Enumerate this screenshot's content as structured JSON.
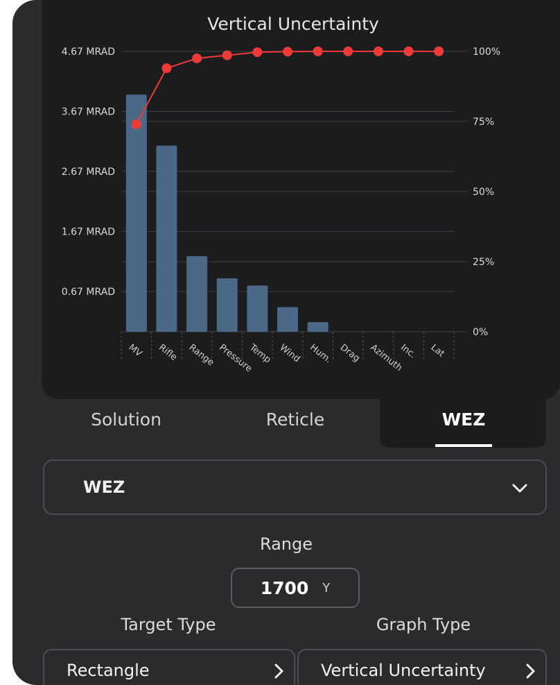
{
  "chart_data": {
    "type": "bar",
    "title": "Vertical Uncertainty",
    "categories": [
      "MV",
      "Rifle",
      "Range",
      "Pressure",
      "Temp",
      "Wind",
      "Hum.",
      "Drag",
      "Azimuth",
      "Inc.",
      "Lat"
    ],
    "series": [
      {
        "type": "bar",
        "axis": "left",
        "values": [
          3.95,
          3.1,
          1.26,
          0.89,
          0.77,
          0.41,
          0.16,
          0,
          0,
          0,
          0
        ]
      },
      {
        "type": "line",
        "axis": "right",
        "values": [
          74,
          94,
          97.5,
          98.6,
          99.7,
          99.9,
          100,
          100,
          100,
          100,
          100
        ]
      }
    ],
    "y_left": {
      "ticks": [
        0.67,
        1.67,
        2.67,
        3.67,
        4.67
      ],
      "tick_labels": [
        "0.67 MRAD",
        "1.67 MRAD",
        "2.67 MRAD",
        "3.67 MRAD",
        "4.67 MRAD"
      ],
      "range": [
        0,
        4.67
      ]
    },
    "y_right": {
      "ticks": [
        0,
        25,
        50,
        75,
        100
      ],
      "tick_labels": [
        "0%",
        "25%",
        "50%",
        "75%",
        "100%"
      ],
      "range": [
        0,
        100
      ]
    },
    "colors": {
      "bar": "#4b6887",
      "line": "#ef3b38",
      "grid": "#3e3f42"
    },
    "grid": true
  },
  "tabs": [
    {
      "label": "Solution",
      "active": false
    },
    {
      "label": "Reticle",
      "active": false
    },
    {
      "label": "WEZ",
      "active": true
    }
  ],
  "mode_select": {
    "value": "WEZ",
    "icon": "chevron-down-icon"
  },
  "range": {
    "label": "Range",
    "value": "1700",
    "unit": "Y"
  },
  "target_type": {
    "label": "Target Type",
    "value": "Rectangle",
    "icon": "chevron-right-icon"
  },
  "graph_type": {
    "label": "Graph Type",
    "value": "Vertical Uncertainty",
    "icon": "chevron-right-icon"
  }
}
